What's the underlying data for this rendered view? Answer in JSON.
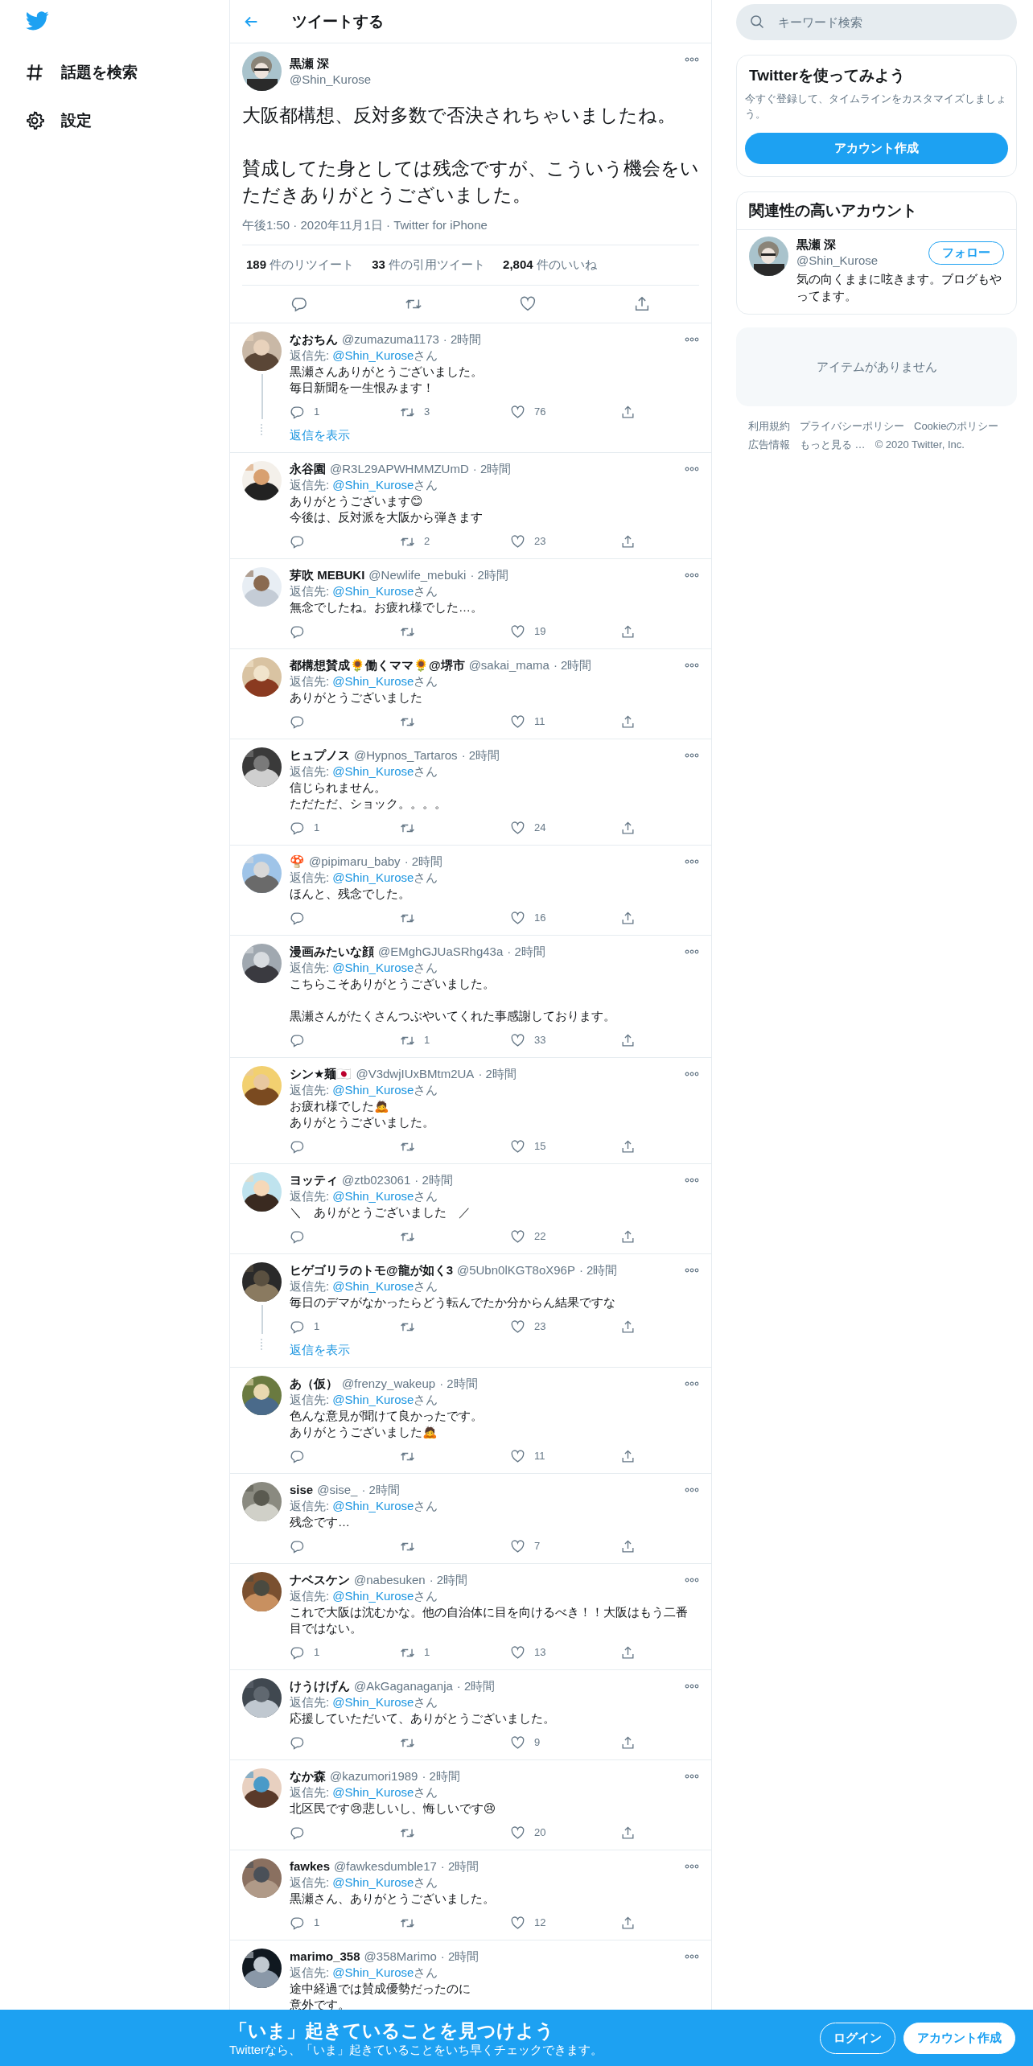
{
  "nav": {
    "items": [
      {
        "label": "話題を検索",
        "kind": "explore"
      },
      {
        "label": "設定",
        "kind": "settings"
      }
    ]
  },
  "header": {
    "title": "ツイートする"
  },
  "tweet": {
    "name": "黒瀬 深",
    "handle": "@Shin_Kurose",
    "body": [
      "大阪都構想、反対多数で否決されちゃいましたね。",
      "賛成してた身としては残念ですが、こういう機会をいただきありがとうございました。"
    ],
    "meta": "午後1:50 · 2020年11月1日 · Twitter for iPhone",
    "stats": [
      "**189** 件のリツイート",
      "**33** 件の引用ツイート",
      "**2,804** 件のいいね"
    ]
  },
  "replies": [
    {
      "name": "なおちん",
      "handle": "@zumazuma1173",
      "time": "· 2時間",
      "reply_prefix": "返信先: ",
      "reply_to": "@Shin_Kurose",
      "reply_suffix": "さん",
      "body": [
        [
          "黒瀬さんありがとうございました。",
          "毎日新聞を一生恨みます！"
        ]
      ],
      "replies": "1",
      "retweets": "3",
      "likes": "76",
      "thread": true,
      "show_replies": "返信を表示",
      "show_actions": true
    },
    {
      "name": "永谷園",
      "handle": "@R3L29APWHMMZUmD",
      "time": "· 2時間",
      "reply_prefix": "返信先: ",
      "reply_to": "@Shin_Kurose",
      "reply_suffix": "さん",
      "body": [
        [
          "ありがとうございます😊",
          "今後は、反対派を大阪から弾きます"
        ]
      ],
      "retweets": "2",
      "likes": "23",
      "thread": false,
      "show_actions": true
    },
    {
      "name": "芽吹 MEBUKI",
      "handle": "@Newlife_mebuki",
      "time": "· 2時間",
      "reply_prefix": "返信先: ",
      "reply_to": "@Shin_Kurose",
      "reply_suffix": "さん",
      "body": [
        [
          "無念でしたね。お疲れ様でした…。"
        ]
      ],
      "likes": "19",
      "thread": false,
      "show_actions": true
    },
    {
      "name": "都構想賛成🌻働くママ🌻@堺市",
      "handle": "@sakai_mama",
      "time": "· 2時間",
      "reply_prefix": "返信先: ",
      "reply_to": "@Shin_Kurose",
      "reply_suffix": "さん",
      "body": [
        [
          "ありがとうございました"
        ]
      ],
      "likes": "11",
      "thread": false,
      "show_actions": true
    },
    {
      "name": "ヒュプノス",
      "handle": "@Hypnos_Tartaros",
      "time": "· 2時間",
      "reply_prefix": "返信先: ",
      "reply_to": "@Shin_Kurose",
      "reply_suffix": "さん",
      "body": [
        [
          "信じられません。",
          "ただただ、ショック。。。。"
        ]
      ],
      "replies": "1",
      "likes": "24",
      "thread": false,
      "show_actions": true
    },
    {
      "name": "🍄",
      "handle": "@pipimaru_baby",
      "time": "· 2時間",
      "reply_prefix": "返信先: ",
      "reply_to": "@Shin_Kurose",
      "reply_suffix": "さん",
      "body": [
        [
          "ほんと、残念でした。"
        ]
      ],
      "likes": "16",
      "thread": false,
      "show_actions": true
    },
    {
      "name": "漫画みたいな顔",
      "handle": "@EMghGJUaSRhg43a",
      "time": "· 2時間",
      "reply_prefix": "返信先: ",
      "reply_to": "@Shin_Kurose",
      "reply_suffix": "さん",
      "body": [
        [
          "こちらこそありがとうございました。"
        ],
        [
          "黒瀬さんがたくさんつぶやいてくれた事感謝しております。"
        ]
      ],
      "retweets": "1",
      "likes": "33",
      "thread": false,
      "show_actions": true
    },
    {
      "name": "シン★麺🇯🇵",
      "handle": "@V3dwjIUxBMtm2UA",
      "time": "· 2時間",
      "reply_prefix": "返信先: ",
      "reply_to": "@Shin_Kurose",
      "reply_suffix": "さん",
      "body": [
        [
          "お疲れ様でした🙇",
          "ありがとうございました。"
        ]
      ],
      "likes": "15",
      "thread": false,
      "show_actions": true
    },
    {
      "name": "ヨッティ",
      "handle": "@ztb023061",
      "time": "· 2時間",
      "reply_prefix": "返信先: ",
      "reply_to": "@Shin_Kurose",
      "reply_suffix": "さん",
      "body": [
        [
          "＼　ありがとうございました　／"
        ]
      ],
      "likes": "22",
      "thread": false,
      "show_actions": true
    },
    {
      "name": "ヒゲゴリラのトモ@龍が如く3",
      "handle": "@5Ubn0lKGT8oX96P",
      "time": "· 2時間",
      "reply_prefix": "返信先: ",
      "reply_to": "@Shin_Kurose",
      "reply_suffix": "さん",
      "body": [
        [
          "毎日のデマがなかったらどう転んでたか分からん結果ですな"
        ]
      ],
      "replies": "1",
      "likes": "23",
      "thread": true,
      "show_replies": "返信を表示",
      "show_actions": true
    },
    {
      "name": "あ（仮）",
      "handle": "@frenzy_wakeup",
      "time": "· 2時間",
      "reply_prefix": "返信先: ",
      "reply_to": "@Shin_Kurose",
      "reply_suffix": "さん",
      "body": [
        [
          "色んな意見が聞けて良かったです。",
          "ありがとうございました🙇"
        ]
      ],
      "likes": "11",
      "thread": false,
      "show_actions": true
    },
    {
      "name": "sise",
      "handle": "@sise_",
      "time": "· 2時間",
      "reply_prefix": "返信先: ",
      "reply_to": "@Shin_Kurose",
      "reply_suffix": "さん",
      "body": [
        [
          "残念です…"
        ]
      ],
      "likes": "7",
      "thread": false,
      "show_actions": true
    },
    {
      "name": "ナベスケン",
      "handle": "@nabesuken",
      "time": "· 2時間",
      "reply_prefix": "返信先: ",
      "reply_to": "@Shin_Kurose",
      "reply_suffix": "さん",
      "body": [
        [
          "これで大阪は沈むかな。他の自治体に目を向けるべき！！大阪はもう二番目ではない。"
        ]
      ],
      "replies": "1",
      "retweets": "1",
      "likes": "13",
      "thread": false,
      "show_actions": true
    },
    {
      "name": "けうけげん",
      "handle": "@AkGaganaganja",
      "time": "· 2時間",
      "reply_prefix": "返信先: ",
      "reply_to": "@Shin_Kurose",
      "reply_suffix": "さん",
      "body": [
        [
          "応援していただいて、ありがとうございました。"
        ]
      ],
      "likes": "9",
      "thread": false,
      "show_actions": true
    },
    {
      "name": "なか森",
      "handle": "@kazumori1989",
      "time": "· 2時間",
      "reply_prefix": "返信先: ",
      "reply_to": "@Shin_Kurose",
      "reply_suffix": "さん",
      "body": [
        [
          "北区民です😢悲しいし、悔しいです😢"
        ]
      ],
      "likes": "20",
      "thread": false,
      "show_actions": true
    },
    {
      "name": "fawkes",
      "handle": "@fawkesdumble17",
      "time": "· 2時間",
      "reply_prefix": "返信先: ",
      "reply_to": "@Shin_Kurose",
      "reply_suffix": "さん",
      "body": [
        [
          "黒瀬さん、ありがとうございました。"
        ]
      ],
      "replies": "1",
      "likes": "12",
      "thread": false,
      "show_actions": true
    },
    {
      "name": "marimo_358",
      "handle": "@358Marimo",
      "time": "· 2時間",
      "reply_prefix": "返信先: ",
      "reply_to": "@Shin_Kurose",
      "reply_suffix": "さん",
      "body": [
        [
          "途中経過では賛成優勢だったのに",
          "意外です。"
        ]
      ],
      "thread": false,
      "show_actions": false
    }
  ],
  "sidebar": {
    "search": {
      "placeholder": "キーワード検索"
    },
    "signup": {
      "title": "Twitterを使ってみよう",
      "text": "今すぐ登録して、タイムラインをカスタマイズしましょう。",
      "button": "アカウント作成"
    },
    "related": {
      "title": "関連性の高いアカウント",
      "name": "黒瀬 深",
      "handle": "@Shin_Kurose",
      "bio": "気の向くままに呟きます。ブログもやってます。",
      "button": "フォロー"
    },
    "trends": {
      "empty": "アイテムがありません"
    },
    "footer": {
      "links": [
        "利用規約",
        "プライバシーポリシー",
        "Cookieのポリシー",
        "広告情報",
        "もっと見る …"
      ],
      "copyright": "© 2020 Twitter, Inc."
    }
  },
  "banner": {
    "title": "「いま」起きていることを見つけよう",
    "text": "Twitterなら、「いま」起きていることをいち早くチェックできます。",
    "buttons": [
      {
        "label": "ログイン",
        "kind": "outline"
      },
      {
        "label": "アカウント作成",
        "kind": "filled"
      }
    ]
  }
}
